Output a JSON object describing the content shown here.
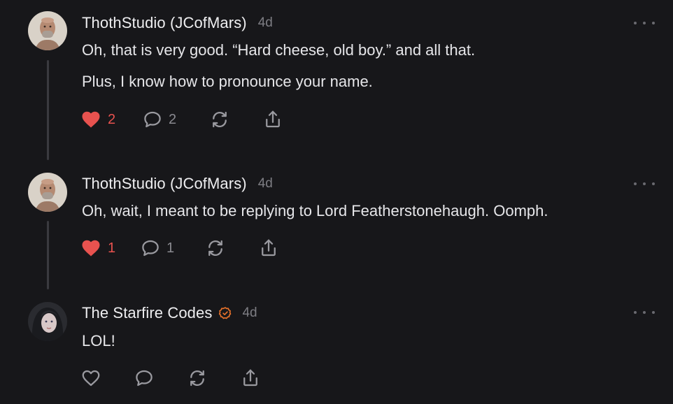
{
  "posts": [
    {
      "author": "ThothStudio (JCofMars)",
      "time": "4d",
      "lines": [
        "Oh, that is very good. “Hard cheese, old boy.” and all that.",
        "Plus, I know how to pronounce your name."
      ],
      "likes": "2",
      "liked": true,
      "replies": "2"
    },
    {
      "author": "ThothStudio (JCofMars)",
      "time": "4d",
      "lines": [
        "Oh, wait, I meant to be replying to Lord Featherstonehaugh. Oomph."
      ],
      "likes": "1",
      "liked": true,
      "replies": "1"
    },
    {
      "author": "The Starfire Codes",
      "verified": true,
      "time": "4d",
      "lines": [
        "LOL!"
      ],
      "liked": false
    }
  ],
  "colors": {
    "background": "#17171a",
    "liked": "#e8524f",
    "verified_badge": "#e8722a",
    "muted": "#8a8a90"
  }
}
